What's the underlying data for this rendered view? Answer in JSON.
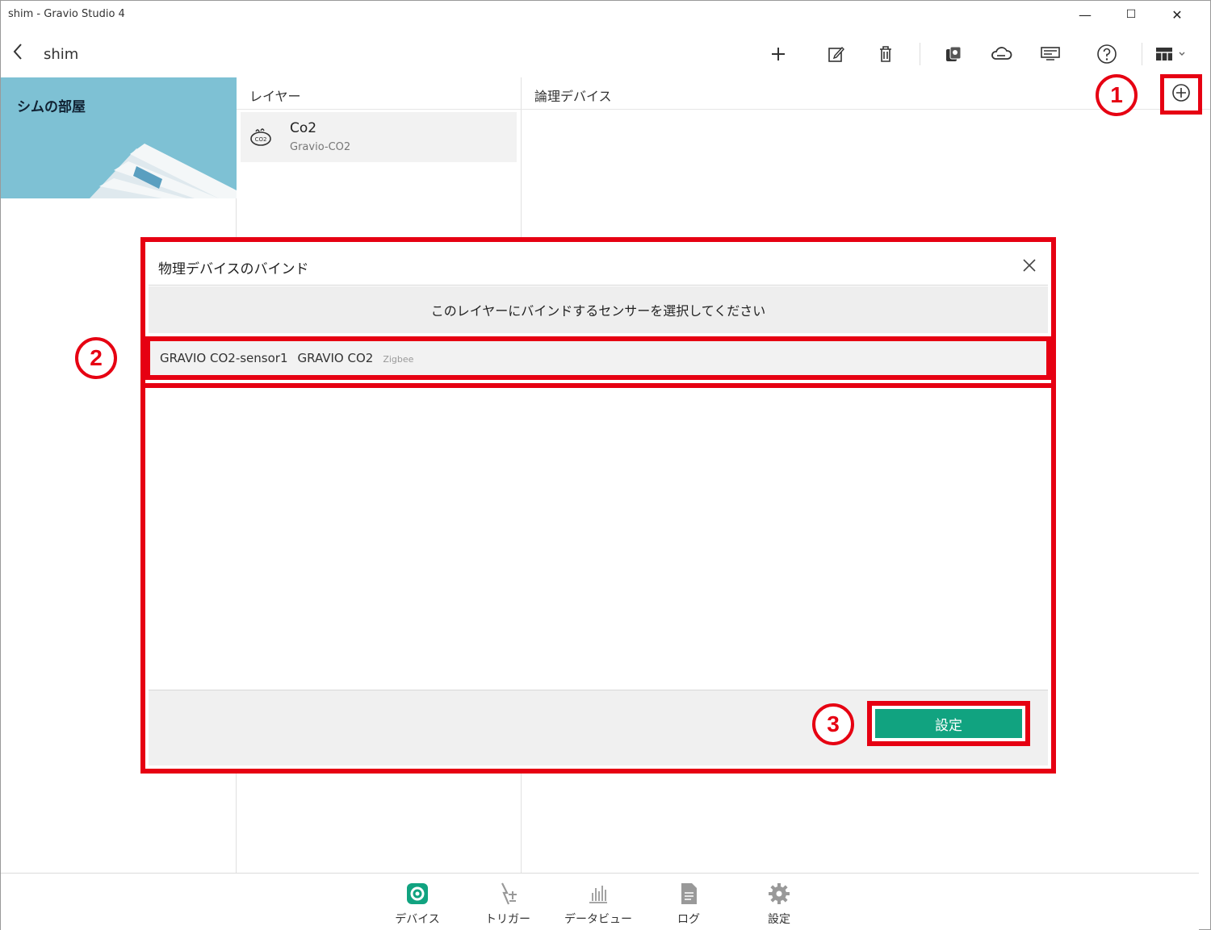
{
  "window": {
    "title": "shim - Gravio Studio 4",
    "controls": {
      "minimize": "—",
      "maximize": "☐",
      "close": "✕"
    }
  },
  "toolbar": {
    "back_icon": "back-chevron-icon",
    "breadcrumb": "shim",
    "icons": [
      "add-icon",
      "edit-icon",
      "delete-icon",
      "device-icon",
      "cloud-icon",
      "list-icon",
      "help-icon",
      "layout-icon"
    ]
  },
  "room": {
    "name": "シムの部屋"
  },
  "layers": {
    "header": "レイヤー",
    "items": [
      {
        "name": "Co2",
        "type": "Gravio-CO2",
        "icon": "co2-sensor-icon"
      }
    ]
  },
  "logical": {
    "header": "論理デバイス",
    "add_icon": "plus-circle-icon"
  },
  "annotations": {
    "n1": "1",
    "n2": "2",
    "n3": "3"
  },
  "dialog": {
    "title": "物理デバイスのバインド",
    "prompt": "このレイヤーにバインドするセンサーを選択してください",
    "sensors": [
      {
        "name": "GRAVIO CO2-sensor1",
        "model": "GRAVIO CO2",
        "protocol": "Zigbee"
      }
    ],
    "apply_label": "設定"
  },
  "nav": {
    "items": [
      {
        "label": "デバイス",
        "icon": "device-gear-icon",
        "active": true
      },
      {
        "label": "トリガー",
        "icon": "trigger-icon",
        "active": false
      },
      {
        "label": "データビューア",
        "icon": "bar-chart-icon",
        "active": false
      },
      {
        "label": "ログ",
        "icon": "document-icon",
        "active": false
      },
      {
        "label": "設定",
        "icon": "gear-icon",
        "active": false
      }
    ]
  },
  "colors": {
    "accent": "#11a380",
    "annotation": "#e60012",
    "room_tile": "#7ec1d4"
  }
}
